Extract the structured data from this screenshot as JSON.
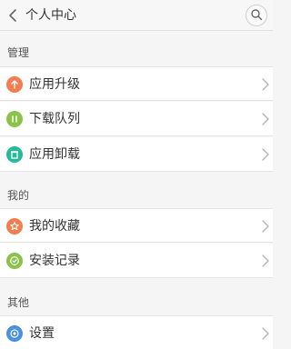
{
  "header": {
    "title": "个人中心"
  },
  "sections": {
    "manage": {
      "label": "管理",
      "items": [
        {
          "label": "应用升级",
          "icon": "arrow-up-icon",
          "color": "#f47c50"
        },
        {
          "label": "下载队列",
          "icon": "download-queue-icon",
          "color": "#8bc34a"
        },
        {
          "label": "应用卸载",
          "icon": "trash-icon",
          "color": "#26b99a"
        }
      ]
    },
    "mine": {
      "label": "我的",
      "items": [
        {
          "label": "我的收藏",
          "icon": "star-icon",
          "color": "#f47c50"
        },
        {
          "label": "安装记录",
          "icon": "check-icon",
          "color": "#8bc34a"
        }
      ]
    },
    "other": {
      "label": "其他",
      "items": [
        {
          "label": "设置",
          "icon": "settings-icon",
          "color": "#4a90e2"
        }
      ]
    }
  }
}
